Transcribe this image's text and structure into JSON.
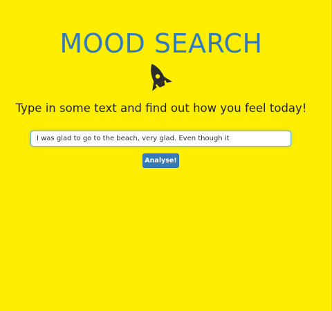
{
  "page": {
    "title": "MOOD SEARCH",
    "subtitle": "Type in some text and find out how you feel today!",
    "icon": "rocket-icon"
  },
  "form": {
    "input_value": "I was glad to go to the beach, very glad. Even though it",
    "analyse_label": "Analyse!"
  },
  "colors": {
    "background": "#ffee00",
    "accent": "#337ab7",
    "text": "#222222"
  }
}
